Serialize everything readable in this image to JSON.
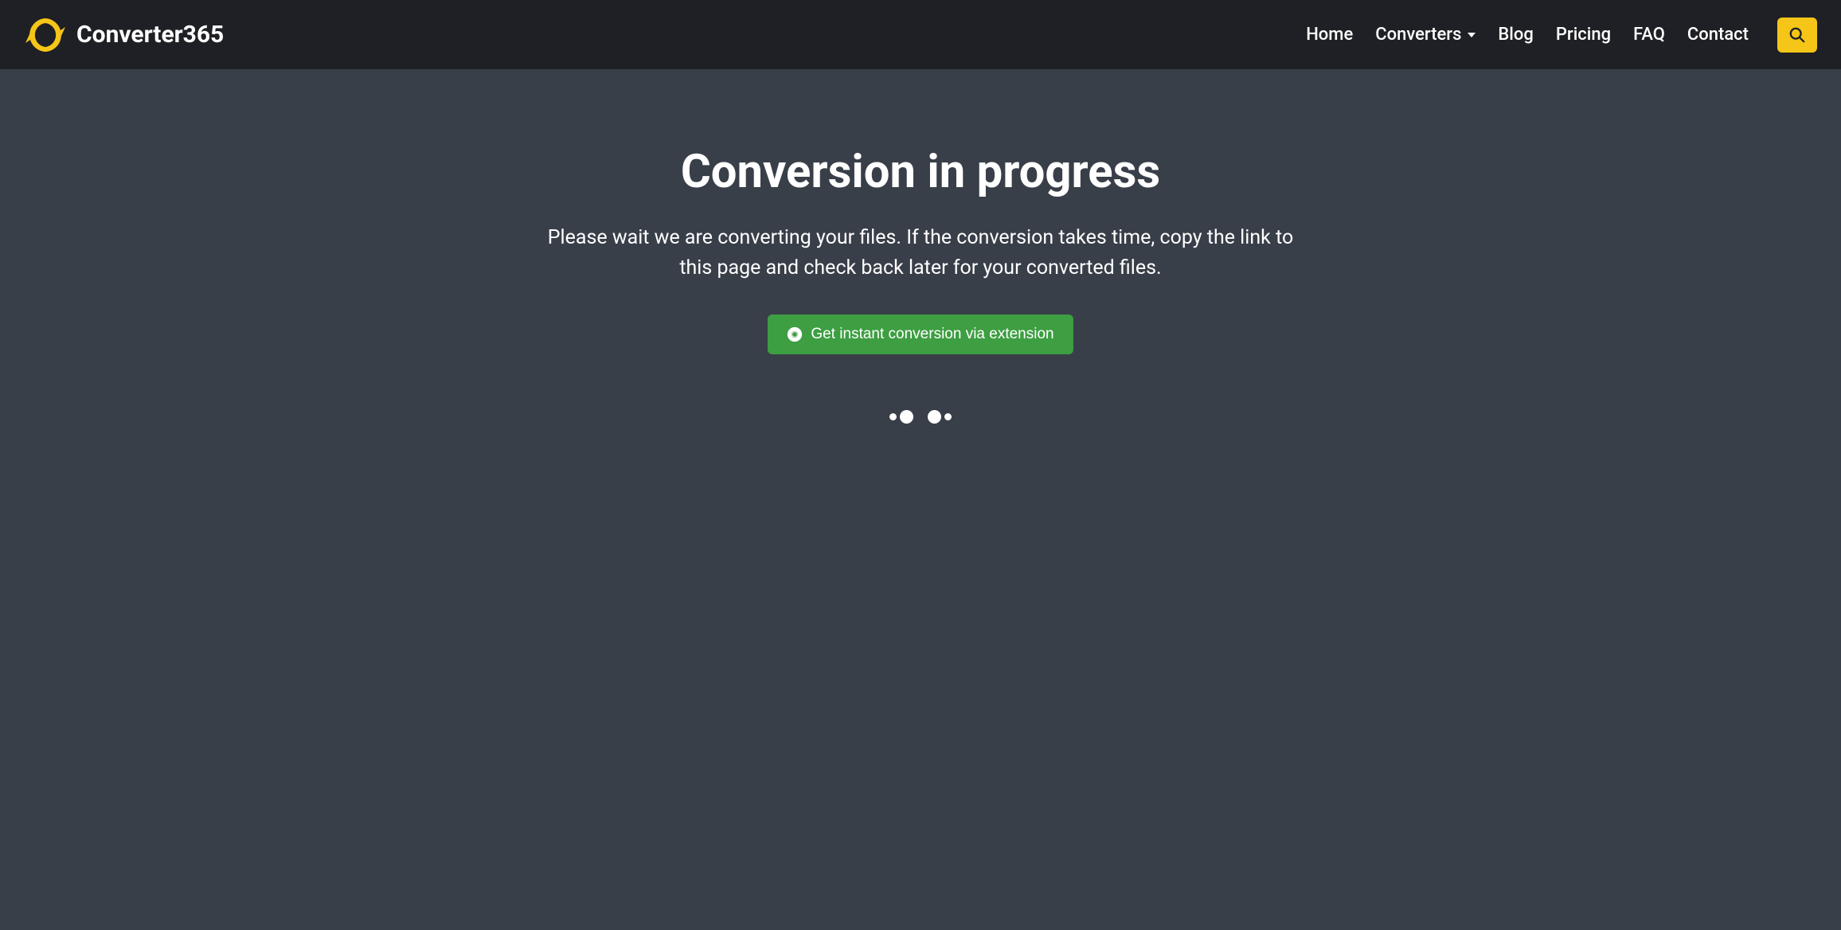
{
  "header": {
    "logo_text": "Converter365",
    "nav": {
      "home": "Home",
      "converters": "Converters",
      "blog": "Blog",
      "pricing": "Pricing",
      "faq": "FAQ",
      "contact": "Contact"
    }
  },
  "main": {
    "title": "Conversion in progress",
    "subtitle": "Please wait we are converting your files. If the conversion takes time, copy the link to this page and check back later for your converted files.",
    "extension_button": "Get instant conversion via extension"
  },
  "colors": {
    "accent": "#f5c518",
    "button": "#3d9e42",
    "header_bg": "#1f2025",
    "body_bg": "#393f49"
  }
}
